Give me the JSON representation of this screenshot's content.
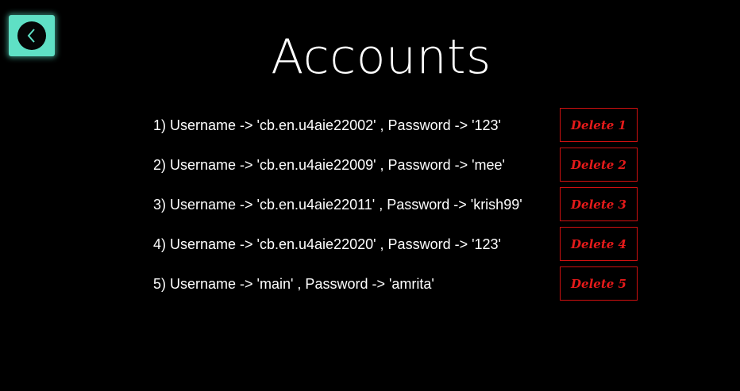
{
  "header": {
    "title": "Accounts",
    "back_icon": "chevron-left-icon",
    "back_color": "#5fe0c5"
  },
  "accounts": [
    {
      "text": "1) Username -> 'cb.en.u4aie22002' , Password -> '123'",
      "delete_label": "Delete 1"
    },
    {
      "text": "2) Username -> 'cb.en.u4aie22009' , Password -> 'mee'",
      "delete_label": "Delete 2"
    },
    {
      "text": "3) Username -> 'cb.en.u4aie22011' , Password -> 'krish99'",
      "delete_label": "Delete 3"
    },
    {
      "text": "4) Username -> 'cb.en.u4aie22020' , Password -> '123'",
      "delete_label": "Delete 4"
    },
    {
      "text": "5) Username -> 'main' , Password -> 'amrita'",
      "delete_label": "Delete 5"
    }
  ],
  "colors": {
    "background": "#000000",
    "text": "#ffffff",
    "delete": "#e51a1a"
  }
}
